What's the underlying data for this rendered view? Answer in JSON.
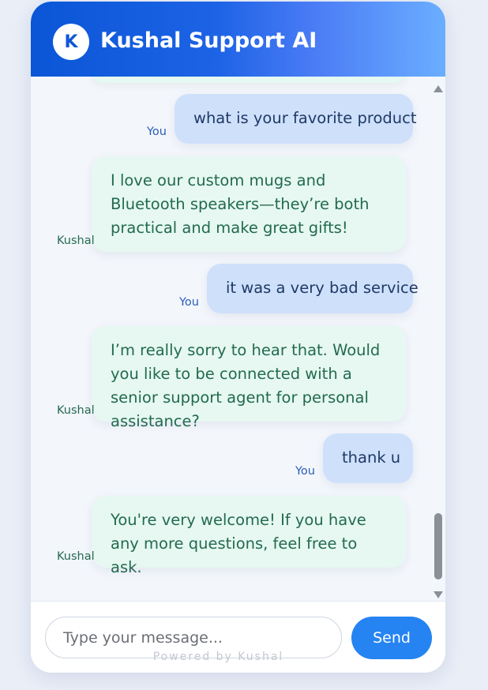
{
  "header": {
    "avatar_letter": "K",
    "title": "Kushal Support AI"
  },
  "messages": [
    {
      "sender": "You",
      "text": "what is your favorite product"
    },
    {
      "sender": "Kushal",
      "text": "I love our custom mugs and Bluetooth speakers—they’re both practical and make great gifts!"
    },
    {
      "sender": "You",
      "text": "it was a very bad service"
    },
    {
      "sender": "Kushal",
      "text": "I’m really sorry to hear that. Would you like to be connected with a senior support agent for personal assistance?"
    },
    {
      "sender": "You",
      "text": "thank u"
    },
    {
      "sender": "Kushal",
      "text": "You're very welcome! If you have any more questions, feel free to ask."
    }
  ],
  "input": {
    "placeholder": "Type your message...",
    "value": ""
  },
  "send_label": "Send",
  "footer": "Powered by Kushal",
  "colors": {
    "header_start": "#0a56d6",
    "header_end": "#6aaeff",
    "user_bubble": "#cfe0fb",
    "bot_bubble": "#e6f8f1",
    "send_button": "#2584f2"
  }
}
